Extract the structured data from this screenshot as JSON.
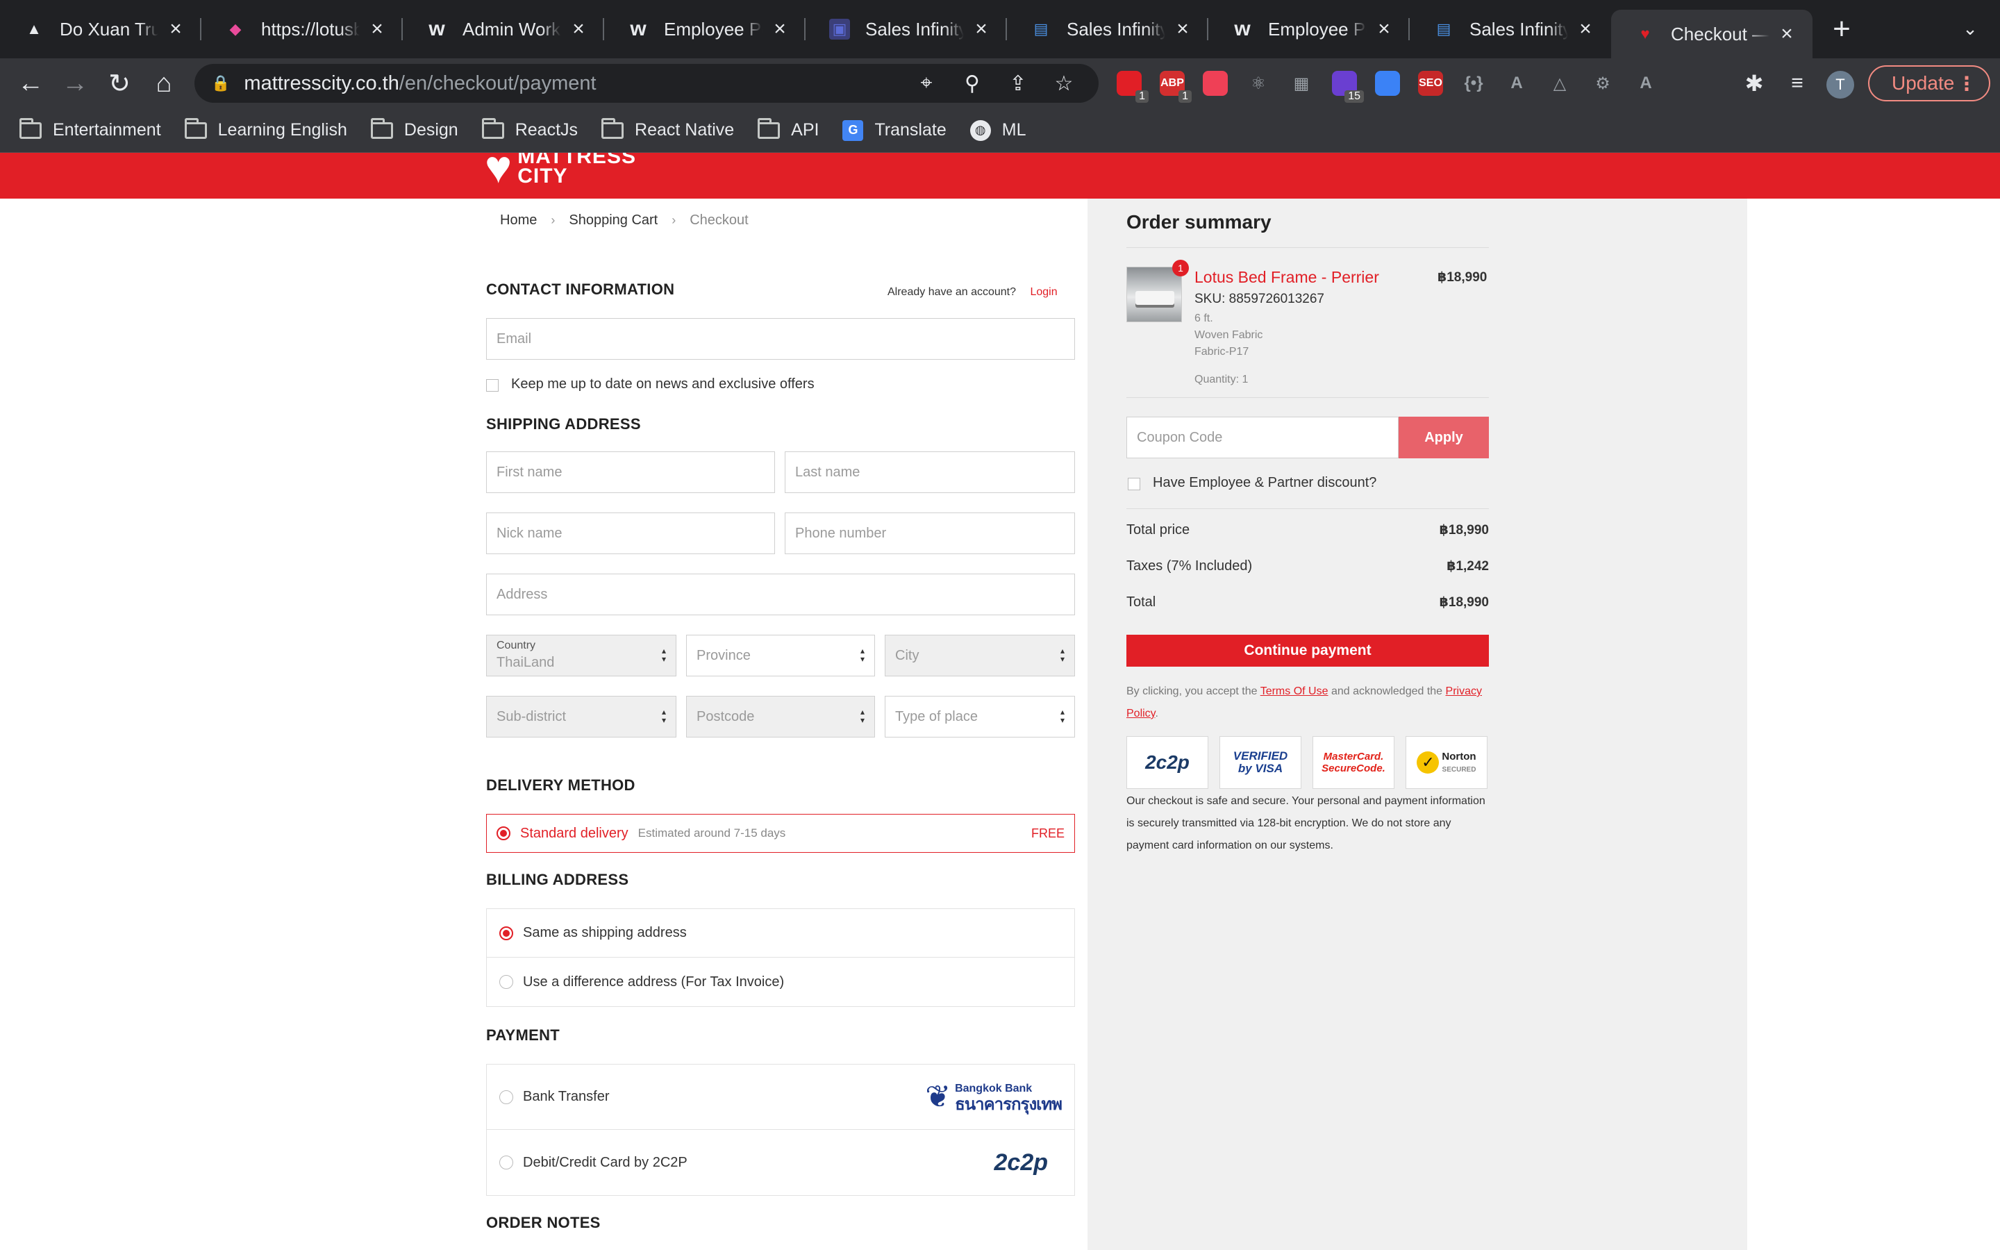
{
  "browser": {
    "tabs": [
      {
        "title": "Do Xuan Trung",
        "favicon": "drive-icon",
        "color": "#e8eaed"
      },
      {
        "title": "https://lotusbe",
        "favicon": "lotus-icon",
        "color": "#e94b9a"
      },
      {
        "title": "Admin Work In",
        "favicon": "w-icon",
        "color": "#e8eaed"
      },
      {
        "title": "Employee Port",
        "favicon": "w-icon",
        "color": "#e8eaed"
      },
      {
        "title": "Sales Infinity",
        "favicon": "app-icon",
        "color": "#5b6bd6"
      },
      {
        "title": "Sales Infinity",
        "favicon": "sheet-icon",
        "color": "#4a90e2"
      },
      {
        "title": "Employee Port",
        "favicon": "w-icon",
        "color": "#e8eaed"
      },
      {
        "title": "Sales Infinity",
        "favicon": "sheet-icon",
        "color": "#4a90e2"
      },
      {
        "title": "Checkout — M",
        "favicon": "heart-icon",
        "color": "#e11f26"
      }
    ],
    "url_host": "mattresscity.co.th",
    "url_path": "/en/checkout/payment",
    "update_label": "Update",
    "profile_initial": "T",
    "extensions": [
      {
        "name": "extension-shield-icon",
        "label": "",
        "badge": "1",
        "color": "#e11f26"
      },
      {
        "name": "adblock-icon",
        "label": "ABP",
        "badge": "1",
        "color": "#d32f2f"
      },
      {
        "name": "pocket-icon",
        "label": "",
        "badge": "",
        "color": "#ef4056"
      },
      {
        "name": "react-devtools-icon",
        "label": "⚛",
        "badge": "",
        "color": "#35363a"
      },
      {
        "name": "qr-code-icon",
        "label": "▦",
        "badge": "",
        "color": "#35363a"
      },
      {
        "name": "extension-purple-icon",
        "label": "",
        "badge": "15",
        "color": "#6a3fd1"
      },
      {
        "name": "mail-icon",
        "label": "",
        "badge": "",
        "color": "#3b82f6"
      },
      {
        "name": "seo-icon",
        "label": "SEO",
        "badge": "",
        "color": "#c62828"
      },
      {
        "name": "json-icon",
        "label": "{•}",
        "badge": "",
        "color": "#35363a"
      },
      {
        "name": "a-circle-icon",
        "label": "A",
        "badge": "",
        "color": "#35363a"
      },
      {
        "name": "triangle-icon",
        "label": "△",
        "badge": "",
        "color": "#35363a"
      },
      {
        "name": "gear-box-icon",
        "label": "⚙",
        "badge": "",
        "color": "#35363a"
      },
      {
        "name": "a-outline-icon",
        "label": "A",
        "badge": "",
        "color": "#35363a"
      }
    ],
    "bookmarks": [
      {
        "label": "Entertainment",
        "type": "folder"
      },
      {
        "label": "Learning English",
        "type": "folder"
      },
      {
        "label": "Design",
        "type": "folder"
      },
      {
        "label": "ReactJs",
        "type": "folder"
      },
      {
        "label": "React Native",
        "type": "folder"
      },
      {
        "label": "API",
        "type": "folder"
      },
      {
        "label": "Translate",
        "type": "translate"
      },
      {
        "label": "ML",
        "type": "globe"
      }
    ]
  },
  "site": {
    "logo_line1": "MATTRESS",
    "logo_line2": "CITY",
    "brand_color": "#e11f26"
  },
  "breadcrumb": {
    "home": "Home",
    "cart": "Shopping Cart",
    "current": "Checkout"
  },
  "contact": {
    "title": "CONTACT INFORMATION",
    "already": "Already have an account?",
    "login": "Login",
    "email_placeholder": "Email",
    "newsletter": "Keep me up to date on news and exclusive offers"
  },
  "shipping": {
    "title": "SHIPPING ADDRESS",
    "first_name": "First name",
    "last_name": "Last name",
    "nick_name": "Nick name",
    "phone": "Phone number",
    "address": "Address",
    "country_label": "Country",
    "country_value": "ThaiLand",
    "province": "Province",
    "city": "City",
    "sub_district": "Sub-district",
    "postcode": "Postcode",
    "type_of_place": "Type of place"
  },
  "delivery": {
    "title": "DELIVERY METHOD",
    "name": "Standard delivery",
    "estimate": "Estimated around 7-15 days",
    "price": "FREE"
  },
  "billing": {
    "title": "BILLING ADDRESS",
    "same": "Same as shipping address",
    "different": "Use a difference address (For Tax Invoice)"
  },
  "payment": {
    "title": "PAYMENT",
    "bank_transfer": "Bank Transfer",
    "bank_logo_en": "Bangkok Bank",
    "bank_logo_th": "ธนาคารกรุงเทพ",
    "card": "Debit/Credit Card by 2C2P",
    "card_logo": "2c2p"
  },
  "order_notes": {
    "title": "ORDER NOTES"
  },
  "summary": {
    "title": "Order summary",
    "product": {
      "name": "Lotus Bed Frame - Perrier",
      "price": "฿18,990",
      "sku": "SKU: 8859726013267",
      "size": "6 ft.",
      "material": "Woven Fabric",
      "fabric": "Fabric-P17",
      "quantity": "Quantity: 1",
      "qty_badge": "1"
    },
    "coupon_placeholder": "Coupon Code",
    "apply": "Apply",
    "employee_discount": "Have Employee & Partner discount?",
    "total_price_label": "Total price",
    "total_price": "฿18,990",
    "taxes_label": "Taxes (7% Included)",
    "taxes": "฿1,242",
    "total_label": "Total",
    "total": "฿18,990",
    "continue": "Continue payment",
    "accept_pre": "By clicking, you accept the",
    "terms": "Terms Of Use",
    "accept_mid": "and acknowledged the",
    "privacy": "Privacy Policy",
    "accept_end": ".",
    "badge_2c2p": "2c2p",
    "badge_visa_1": "VERIFIED",
    "badge_visa_2": "by VISA",
    "badge_mc_1": "MasterCard.",
    "badge_mc_2": "SecureCode.",
    "badge_norton": "Norton",
    "badge_norton_sub": "SECURED",
    "secure_text": "Our checkout is safe and secure. Your personal and payment information is securely transmitted via 128-bit encryption. We do not store any payment card information on our systems."
  }
}
